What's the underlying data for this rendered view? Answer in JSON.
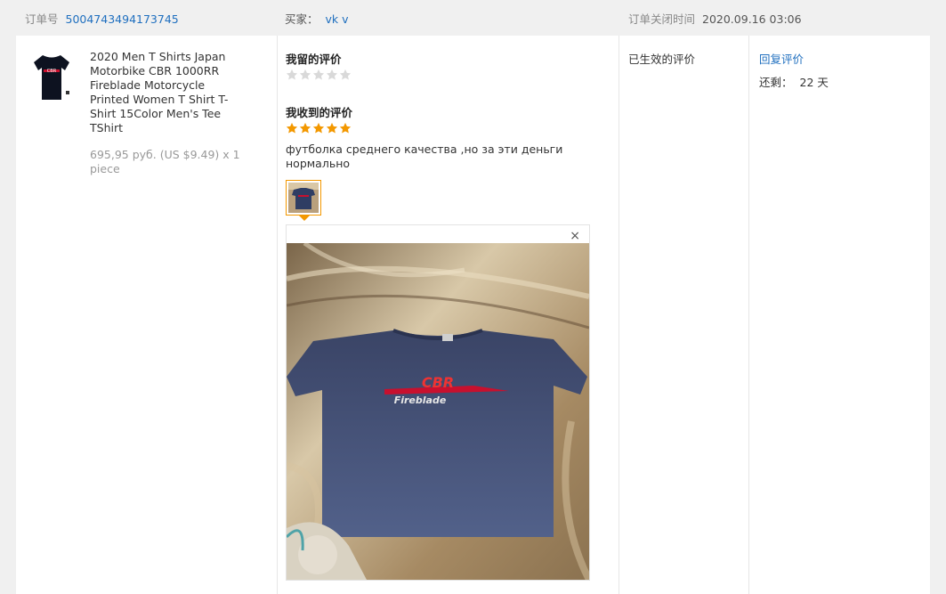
{
  "header": {
    "order_no_label": "订单号",
    "order_no": "5004743494173745",
    "buyer_label": "买家：",
    "buyer_name": "vk v",
    "closed_time_label": "订单关闭时间",
    "closed_time": "2020.09.16 03:06"
  },
  "product": {
    "title": "2020 Men T Shirts Japan Motorbike CBR 1000RR Fireblade Motorcycle Printed Women T Shirt T-Shirt 15Color Men's Tee TShirt",
    "price": "695,95 руб. (US $9.49) x 1 piece",
    "image_icon": "tshirt-icon",
    "image_print_text": "CBR"
  },
  "my_review": {
    "title": "我留的评价",
    "rating": 0,
    "max_rating": 5
  },
  "received_review": {
    "title": "我收到的评价",
    "rating": 5,
    "max_rating": 5,
    "text": "футболка среднего качества ,но за эти деньги нормально",
    "photo_print_main": "CBR",
    "photo_print_sub": "Fireblade"
  },
  "viewer": {
    "close_label": "×"
  },
  "status": {
    "effective_review": "已生效的评价"
  },
  "actions": {
    "reply_label": "回复评价",
    "remaining_label": "还剩：",
    "remaining_value": "22 天"
  },
  "colors": {
    "link": "#1f6fbf",
    "star_on": "#f39800",
    "star_off": "#d9d9d9",
    "thumb_border": "#f39800"
  }
}
